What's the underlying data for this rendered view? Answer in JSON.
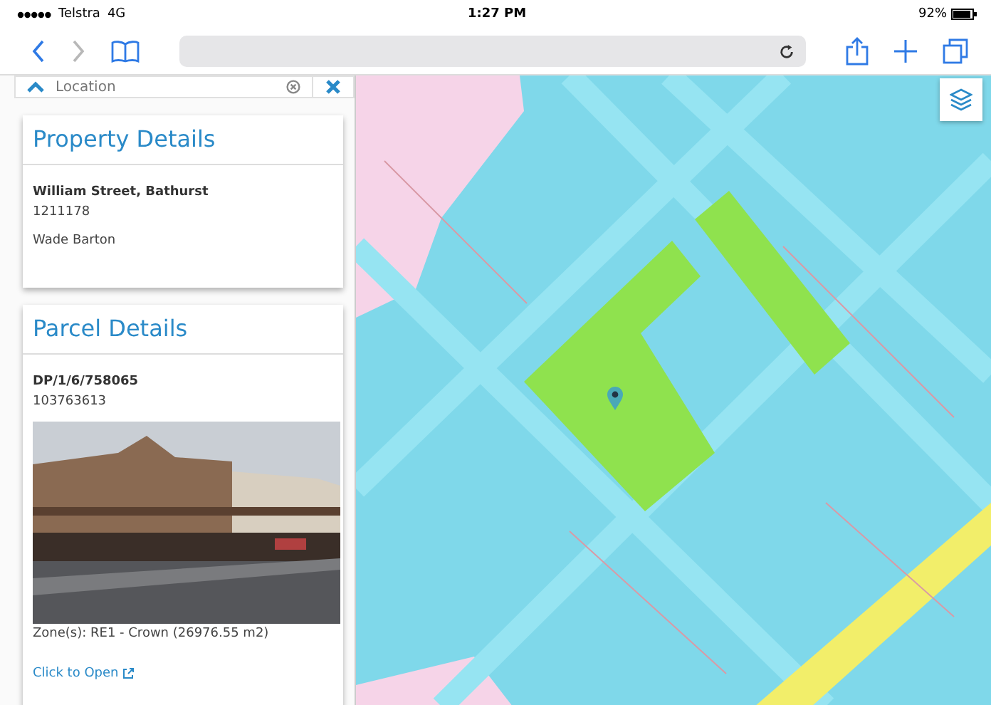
{
  "status_bar": {
    "carrier": "Telstra",
    "network": "4G",
    "time": "1:27 PM",
    "battery": "92%"
  },
  "browser": {
    "back_disabled": false,
    "forward_disabled": true
  },
  "location_search": {
    "placeholder": "Location",
    "expanded": true
  },
  "property_details": {
    "title": "Property Details",
    "address": "William Street, Bathurst",
    "number": "1211178",
    "owner": "Wade Barton"
  },
  "parcel_details": {
    "title": "Parcel Details",
    "lot": "DP/1/6/758065",
    "number": "103763613",
    "zone": "Zone(s): RE1 - Crown (26976.55 m2)",
    "link": "Click to Open"
  }
}
